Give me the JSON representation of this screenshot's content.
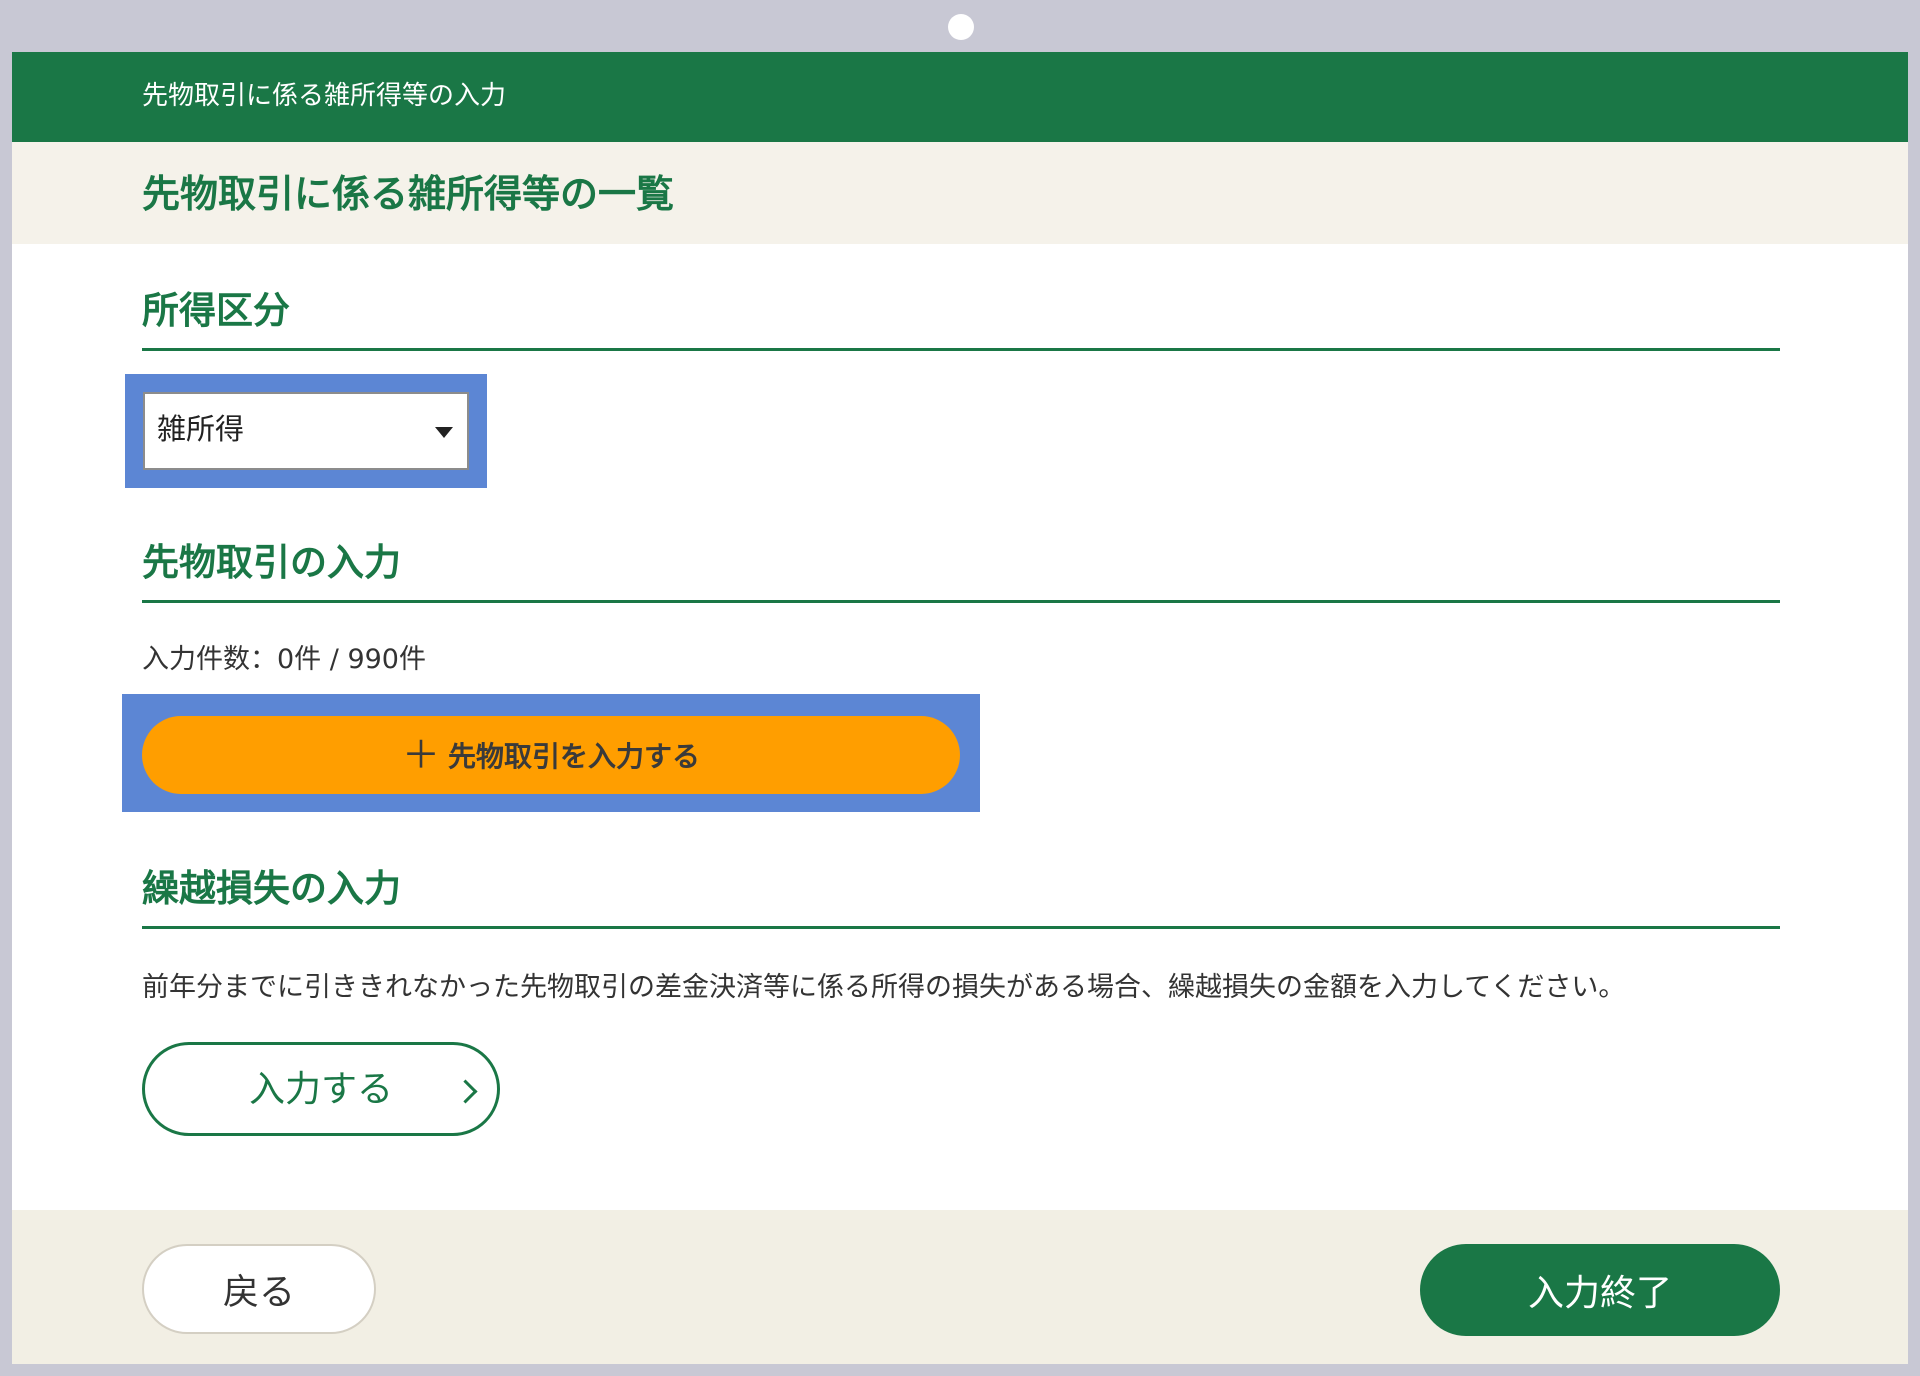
{
  "topbar": {
    "title": "先物取引に係る雑所得等の入力"
  },
  "page": {
    "title": "先物取引に係る雑所得等の一覧"
  },
  "income_category": {
    "heading": "所得区分",
    "select_value": "雑所得"
  },
  "futures": {
    "heading": "先物取引の入力",
    "count_text": "入力件数：0件 / 990件",
    "add_button_plus": "＋",
    "add_button_label": "先物取引を入力する"
  },
  "carryover": {
    "heading": "繰越損失の入力",
    "description": "前年分までに引ききれなかった先物取引の差金決済等に係る所得の損失がある場合、繰越損失の金額を入力してください。",
    "input_button_label": "入力する"
  },
  "footer": {
    "back_label": "戻る",
    "finish_label": "入力終了"
  },
  "colors": {
    "brand_green": "#1a7746",
    "accent_orange": "#ff9e00",
    "focus_blue": "#5c86d4",
    "header_beige": "#f5f2ea"
  },
  "icons": [
    "plus-icon",
    "chevron-right-icon",
    "dropdown-arrow-icon"
  ]
}
